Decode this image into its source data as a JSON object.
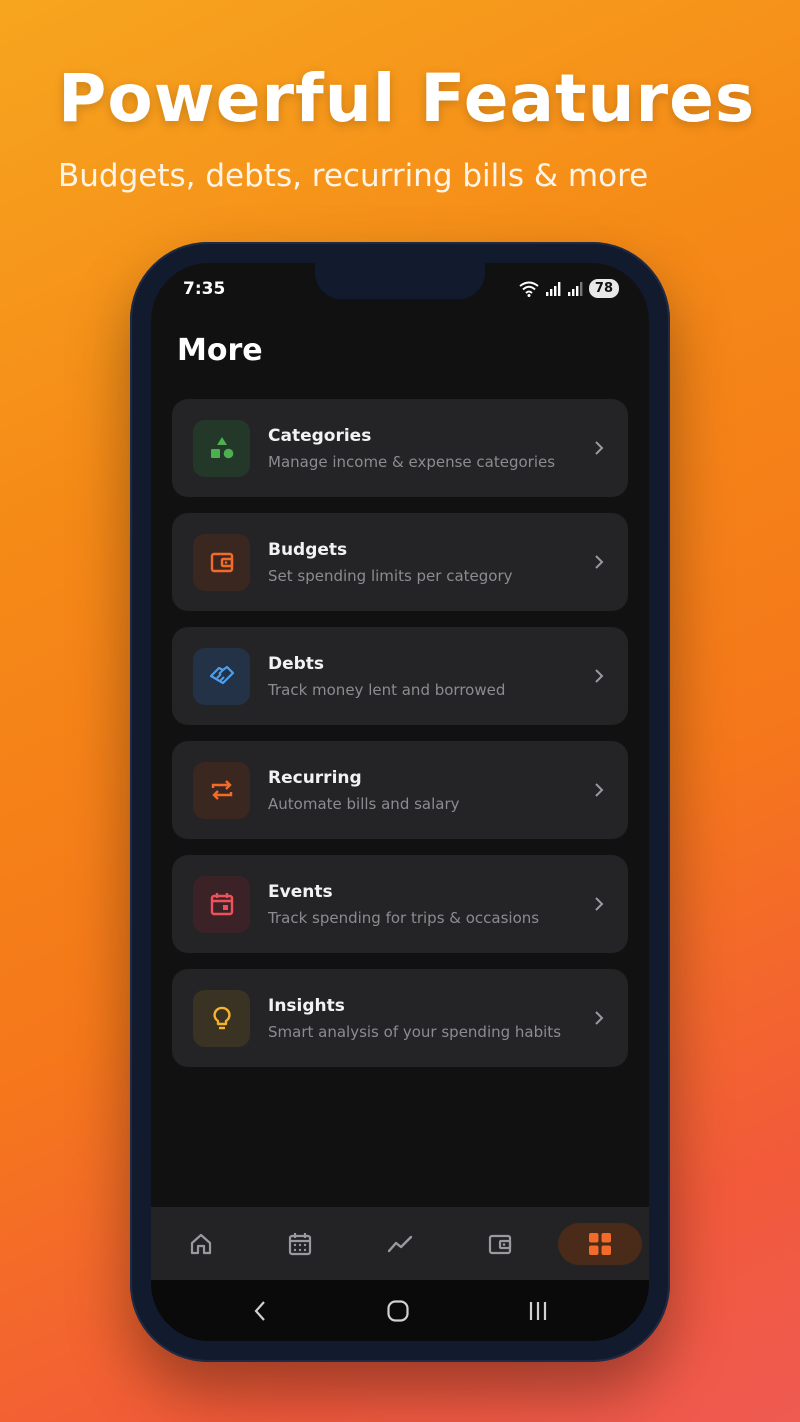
{
  "hero": {
    "title": "Powerful Features",
    "subtitle": "Budgets, debts, recurring bills & more"
  },
  "status_bar": {
    "time": "7:35",
    "battery": "78",
    "icons": [
      "wifi-icon",
      "signal-icon",
      "signal-icon"
    ]
  },
  "page": {
    "title": "More"
  },
  "menu": {
    "items": [
      {
        "title": "Categories",
        "subtitle": "Manage income & expense categories",
        "icon": "shapes-icon",
        "color": "#4caf50",
        "tile": "#24382a"
      },
      {
        "title": "Budgets",
        "subtitle": "Set spending limits per category",
        "icon": "wallet-icon",
        "color": "#f26b2a",
        "tile": "#3a2820"
      },
      {
        "title": "Debts",
        "subtitle": "Track money lent and borrowed",
        "icon": "handshake-icon",
        "color": "#4a9ff0",
        "tile": "#233246"
      },
      {
        "title": "Recurring",
        "subtitle": "Automate bills and salary",
        "icon": "repeat-icon",
        "color": "#f26b2a",
        "tile": "#3a2820"
      },
      {
        "title": "Events",
        "subtitle": "Track spending for trips & occasions",
        "icon": "calendar-icon",
        "color": "#f0505a",
        "tile": "#3b2226"
      },
      {
        "title": "Insights",
        "subtitle": "Smart analysis of your spending habits",
        "icon": "lightbulb-icon",
        "color": "#f5b32e",
        "tile": "#3a3222"
      }
    ]
  },
  "tabbar": {
    "tabs": [
      "home-icon",
      "calendar-icon",
      "chart-line-icon",
      "wallet-icon",
      "grid-icon"
    ],
    "active": "grid-icon",
    "accent": "#f26b2a"
  },
  "system_nav": [
    "back-icon",
    "home-circle-icon",
    "recents-icon"
  ]
}
